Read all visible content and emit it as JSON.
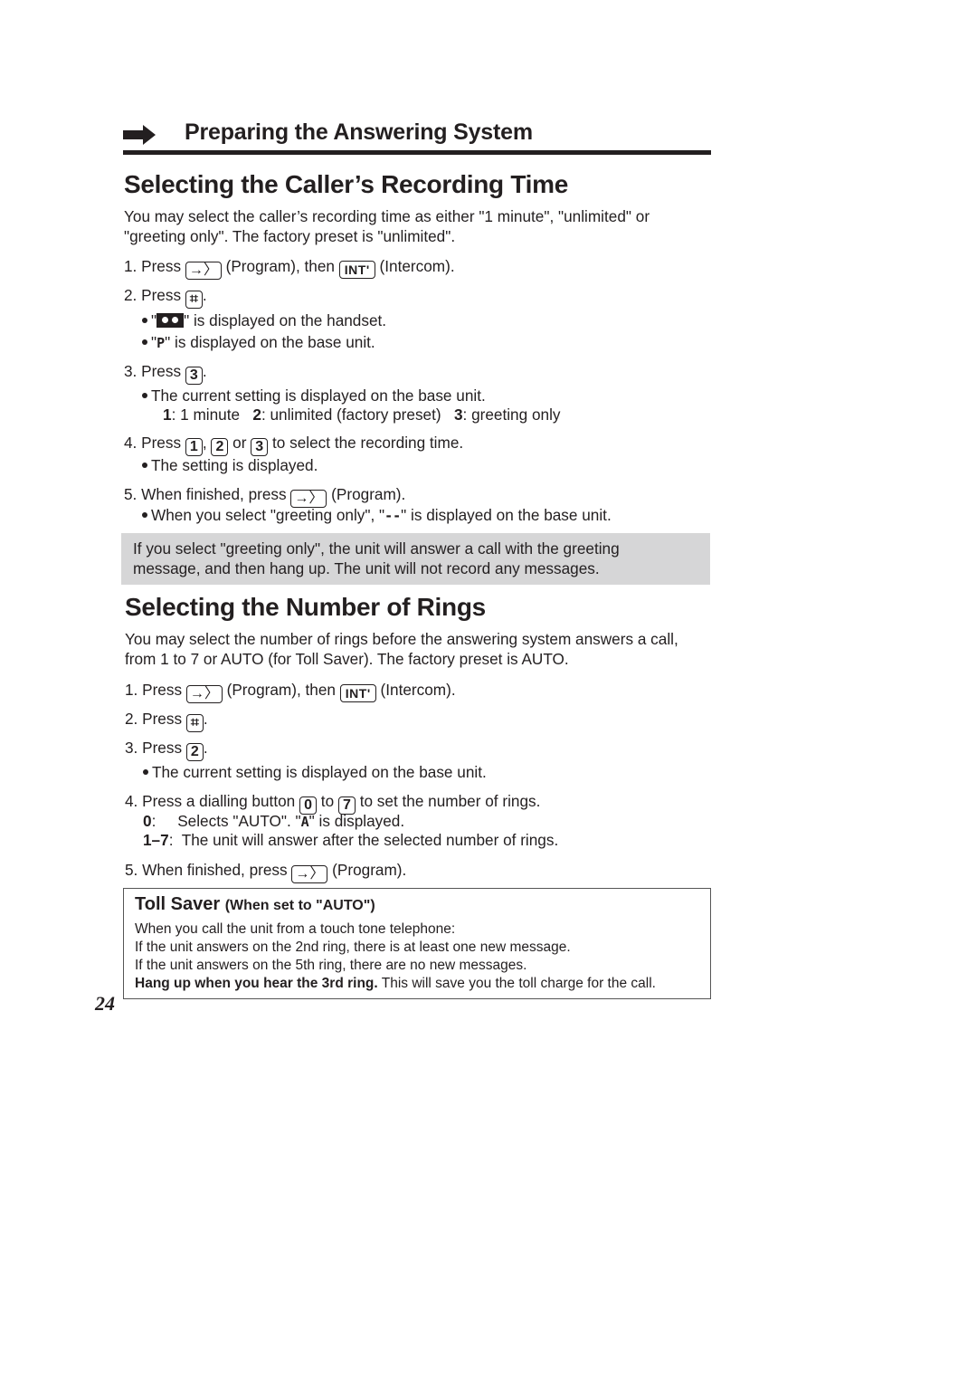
{
  "section": {
    "title": "Preparing the Answering System",
    "icon": "right-arrow-icon"
  },
  "recording": {
    "heading": "Selecting the Caller’s Recording Time",
    "intro": [
      "You may select the caller’s recording time as either \"1 minute\", \"unlimited\" or",
      "\"greeting only\". The factory preset is \"unlimited\"."
    ],
    "step1": {
      "num": "1. Press",
      "program": "(Program), then",
      "int_key": "INT'",
      "intercom": "(Intercom)."
    },
    "step2": {
      "num": "2. Press",
      "end": "."
    },
    "step2_bullets": {
      "b1_pre": "\"",
      "b1_post": "\" is displayed on the handset.",
      "b2_pre": "\"",
      "b2_glyph": "P",
      "b2_post": "\" is displayed on the base unit."
    },
    "step3": {
      "num": "3. Press",
      "key": "3",
      "end": "."
    },
    "step3_bullet": "The current setting is displayed on the base unit.",
    "options": [
      {
        "key": "1",
        "label": ": 1 minute"
      },
      {
        "key": "2",
        "label": ": unlimited (factory preset)"
      },
      {
        "key": "3",
        "label": ": greeting only"
      }
    ],
    "step4": {
      "num": "4. Press",
      "k1": "1",
      "comma": ",",
      "k2": "2",
      "or": "or",
      "k3": "3",
      "rest": "to select the recording time."
    },
    "step4_bullet": "The setting is displayed.",
    "step5": {
      "num": "5. When finished, press",
      "program": "(Program)."
    },
    "step5_bullet": {
      "pre": "When you select \"greeting only\", \"",
      "glyph": "--",
      "post": "\" is displayed on the base unit."
    },
    "note": [
      "If you select \"greeting only\", the unit will answer a call with the greeting",
      "message, and then hang up. The unit will not record any messages."
    ]
  },
  "rings": {
    "heading": "Selecting the Number of Rings",
    "intro": [
      "You may select the number of rings before the answering system answers a call,",
      "from 1 to 7 or AUTO (for Toll Saver). The factory preset is AUTO."
    ],
    "step1": {
      "num": "1. Press",
      "program": "(Program), then",
      "int_key": "INT'",
      "intercom": "(Intercom)."
    },
    "step2": {
      "num": "2. Press",
      "end": "."
    },
    "step3": {
      "num": "3. Press",
      "key": "2",
      "end": "."
    },
    "step3_bullet": "The current setting is displayed on the base unit.",
    "step4": {
      "num": "4. Press a dialling button",
      "k1": "0",
      "to": "to",
      "k2": "7",
      "rest": "to set the number of rings."
    },
    "opt0": {
      "key": "0",
      "pre": ":     Selects \"AUTO\". \"",
      "glyph": "A",
      "post": "\" is displayed."
    },
    "opt17": {
      "key": "1–7",
      "text": ":  The unit will answer after the selected number of rings."
    },
    "step5": {
      "num": "5. When finished, press",
      "program": "(Program)."
    }
  },
  "toll_saver": {
    "title": "Toll Saver",
    "subtitle": "(When set to \"AUTO\")",
    "lines": [
      "When you call the unit from a touch tone telephone:",
      "If the unit answers on the 2nd ring, there is at least one new message.",
      "If the unit answers on the 5th ring, there are no new messages."
    ],
    "last_bold": "Hang up when you hear the 3rd ring.",
    "last_rest": " This will save you the toll charge for the call."
  },
  "page_number": "24"
}
